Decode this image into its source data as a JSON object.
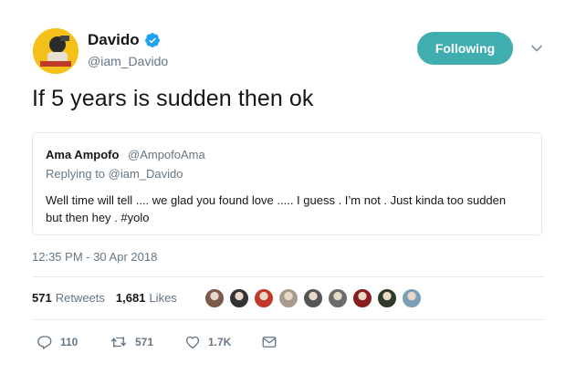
{
  "author": {
    "name": "Davido",
    "handle": "@iam_Davido",
    "verified": true,
    "avatar_icon": "davido-avatar"
  },
  "follow_button": {
    "label": "Following",
    "color": "#40aeb0"
  },
  "tweet": {
    "text": "If 5 years is sudden then ok",
    "timestamp": "12:35 PM - 30 Apr 2018"
  },
  "quoted_tweet": {
    "author_name": "Ama Ampofo",
    "author_handle": "@AmpofoAma",
    "replying_to": "Replying to @iam_Davido",
    "text": "Well time will tell .... we glad you found love ..... I guess . I’m not . Just kinda too sudden but then hey . #yolo"
  },
  "stats": {
    "retweets_count": "571",
    "retweets_label": "Retweets",
    "likes_count": "1,681",
    "likes_label": "Likes"
  },
  "likers": [
    {
      "name": "liker-avatar-1",
      "color": "#7a5a4a"
    },
    {
      "name": "liker-avatar-2",
      "color": "#333333"
    },
    {
      "name": "liker-avatar-3",
      "color": "#c0392b"
    },
    {
      "name": "liker-avatar-4",
      "color": "#a89a8c"
    },
    {
      "name": "liker-avatar-5",
      "color": "#555555"
    },
    {
      "name": "liker-avatar-6",
      "color": "#6b6b6b"
    },
    {
      "name": "liker-avatar-7",
      "color": "#8a1e1e"
    },
    {
      "name": "liker-avatar-8",
      "color": "#2f3a2a"
    },
    {
      "name": "liker-avatar-9",
      "color": "#7b9fb8"
    }
  ],
  "actions": {
    "reply_count": "110",
    "retweet_count": "571",
    "like_count": "1.7K"
  }
}
